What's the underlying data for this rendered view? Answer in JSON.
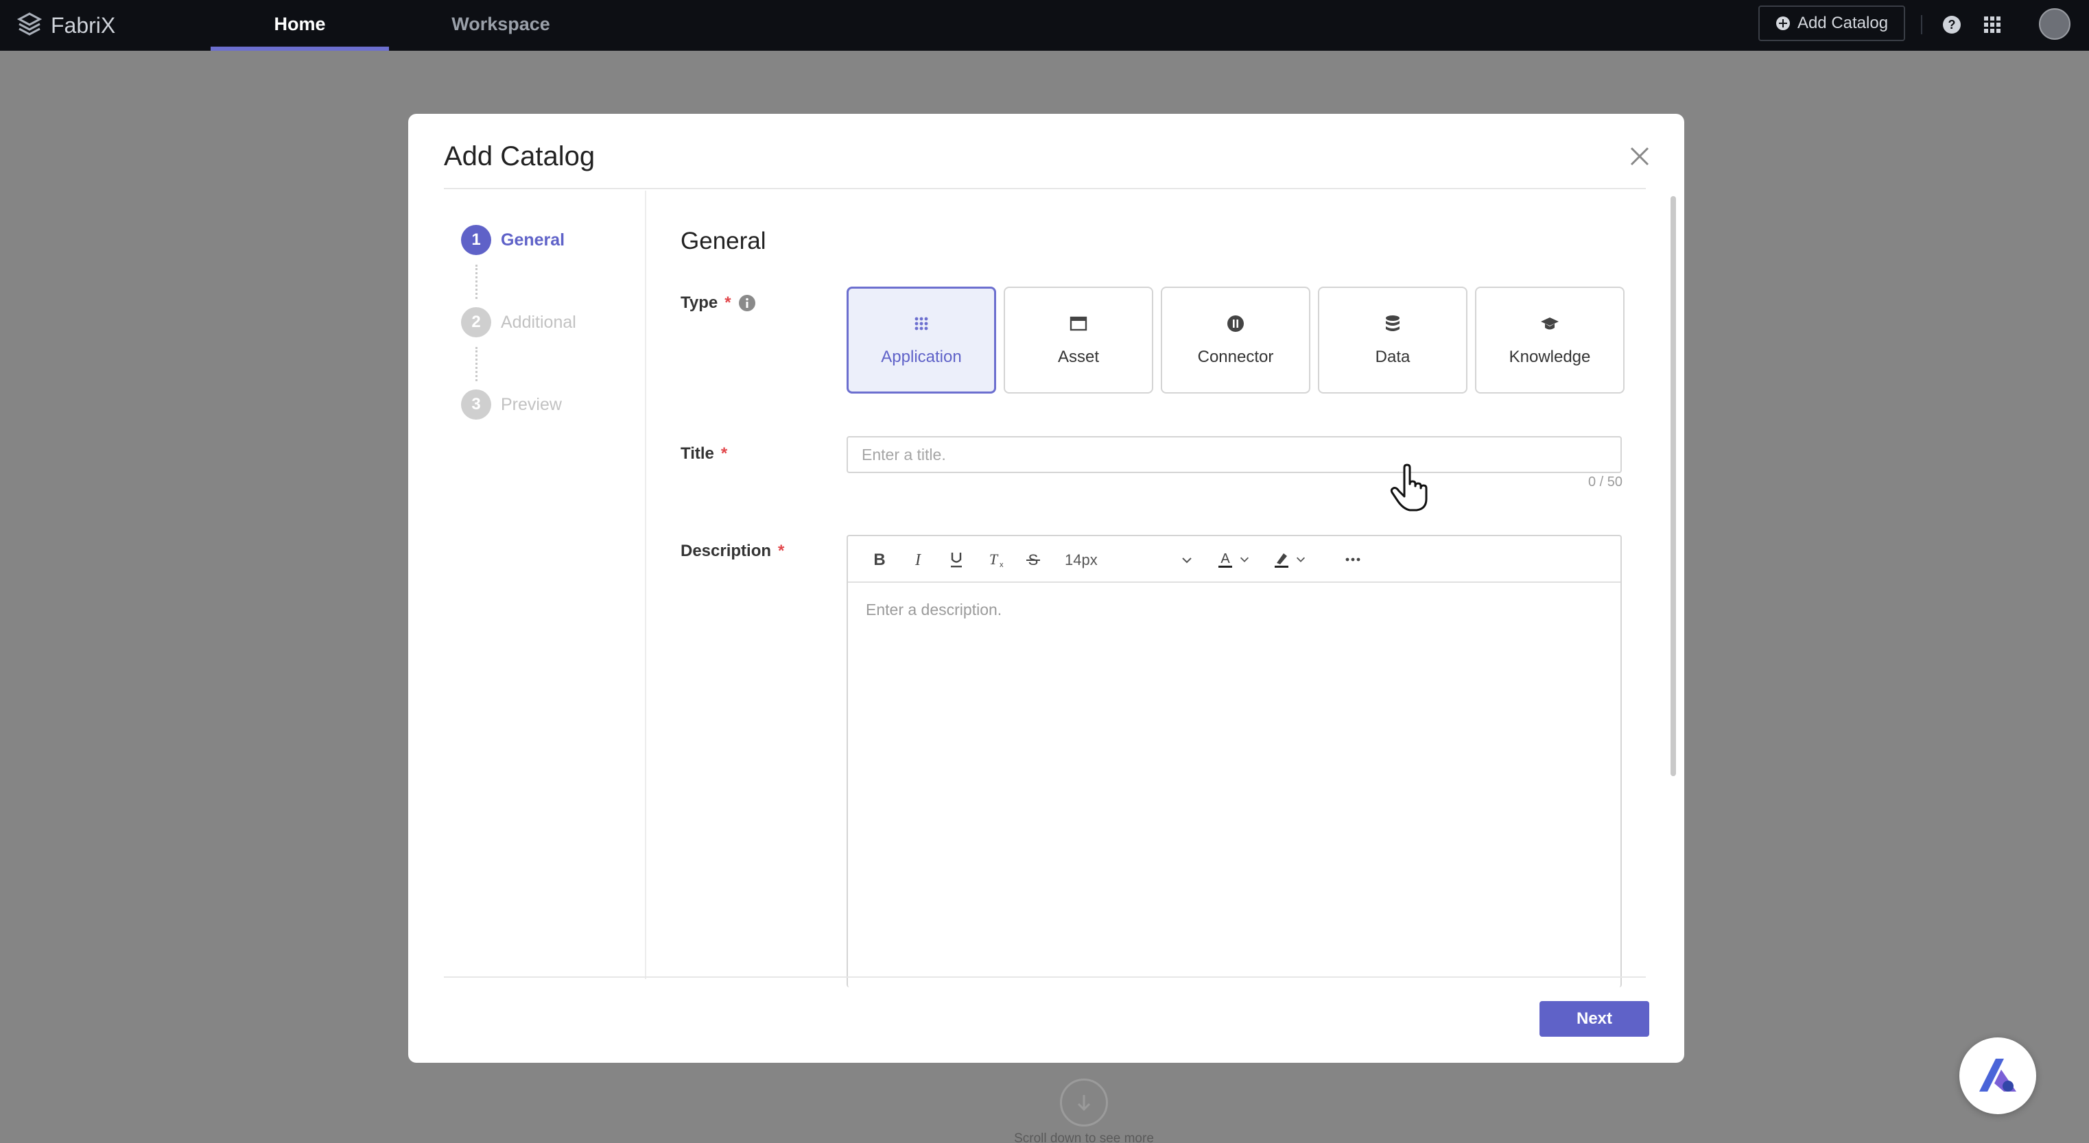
{
  "app": {
    "name": "FabriX"
  },
  "nav": {
    "tabs": [
      {
        "label": "Home"
      },
      {
        "label": "Workspace"
      }
    ],
    "add_catalog_label": "Add Catalog"
  },
  "modal": {
    "title": "Add Catalog",
    "steps": [
      {
        "num": "1",
        "label": "General"
      },
      {
        "num": "2",
        "label": "Additional"
      },
      {
        "num": "3",
        "label": "Preview"
      }
    ],
    "section_title": "General",
    "type": {
      "label": "Type",
      "required": "*",
      "options": [
        {
          "label": "Application",
          "icon": "grid-icon"
        },
        {
          "label": "Asset",
          "icon": "window-icon"
        },
        {
          "label": "Connector",
          "icon": "plug-icon"
        },
        {
          "label": "Data",
          "icon": "database-icon"
        },
        {
          "label": "Knowledge",
          "icon": "graduation-cap-icon"
        }
      ],
      "selected": "Application"
    },
    "title_field": {
      "label": "Title",
      "required": "*",
      "value": "",
      "placeholder": "Enter a title.",
      "counter": "0 / 50"
    },
    "description_field": {
      "label": "Description",
      "required": "*",
      "placeholder": "Enter a description.",
      "font_size": "14px"
    },
    "next_label": "Next"
  },
  "scroll_hint": "Scroll down to see more",
  "colors": {
    "accent": "#5f62c8",
    "topbar": "#0d0f14",
    "required": "#e2474b"
  }
}
